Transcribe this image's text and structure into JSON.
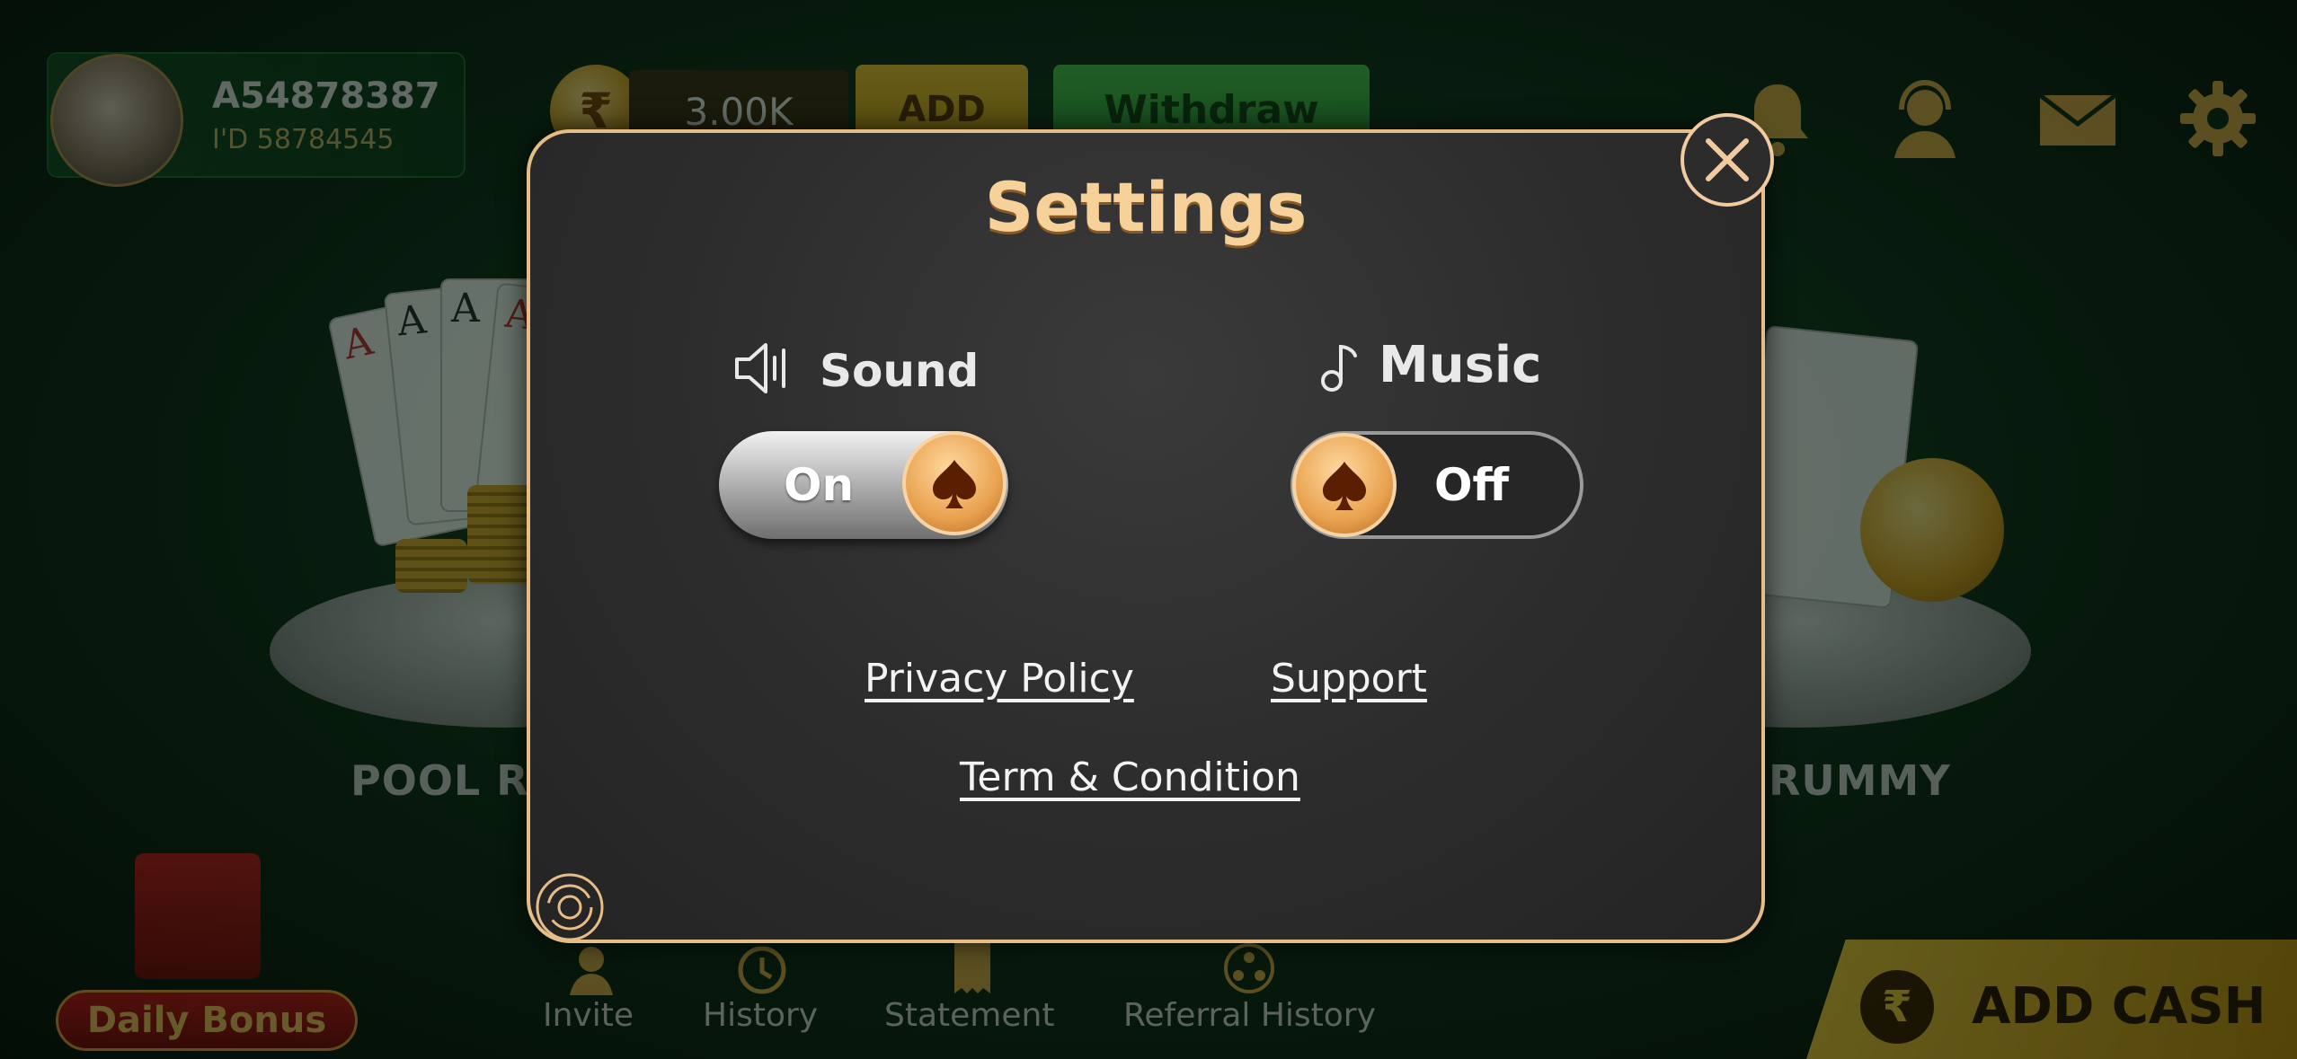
{
  "profile": {
    "username": "A54878387",
    "user_id": "I'D 58784545"
  },
  "wallet": {
    "currency_symbol": "₹",
    "balance": "3.00K",
    "add_label": "ADD",
    "withdraw_label": "Withdraw"
  },
  "top_icons": [
    "bell-icon",
    "support-agent-icon",
    "mail-icon",
    "gear-icon"
  ],
  "background_games": {
    "left_label": "POOL RU",
    "right_label": "RUMMY"
  },
  "daily_bonus_label": "Daily Bonus",
  "bottom_nav": [
    {
      "label": "Invite",
      "icon": "person-icon"
    },
    {
      "label": "History",
      "icon": "history-icon"
    },
    {
      "label": "Statement",
      "icon": "statement-icon"
    },
    {
      "label": "Referral History",
      "icon": "referral-icon"
    }
  ],
  "add_cash": {
    "label": "ADD CASH",
    "symbol": "₹"
  },
  "settings": {
    "title": "Settings",
    "sound": {
      "label": "Sound",
      "state": "On"
    },
    "music": {
      "label": "Music",
      "state": "Off"
    },
    "links": {
      "privacy": "Privacy Policy",
      "support": "Support",
      "terms": "Term & Condition"
    }
  },
  "colors": {
    "accent_gold": "#f6d19a",
    "modal_bg": "#2c2c2c",
    "table_green": "#0b2a15"
  }
}
